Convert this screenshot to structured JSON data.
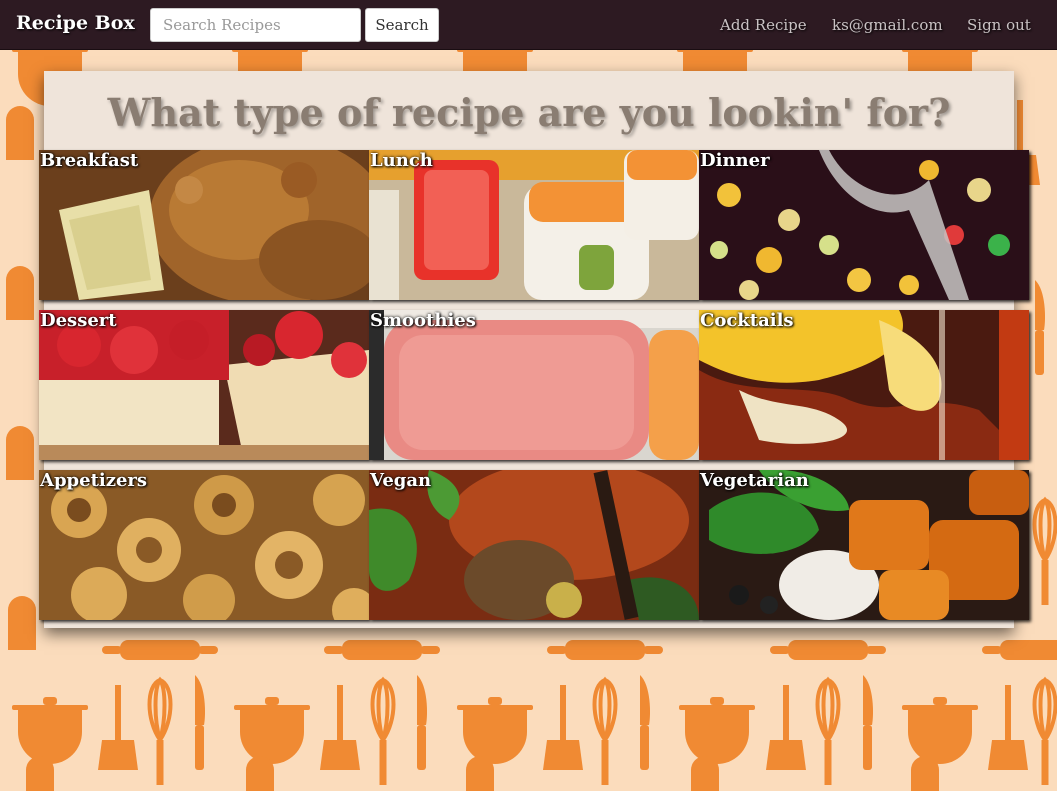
{
  "navbar": {
    "brand": "Recipe Box",
    "search_placeholder": "Search Recipes",
    "search_button": "Search",
    "links": {
      "add_recipe": "Add Recipe",
      "email": "ks@gmail.com",
      "sign_out": "Sign out"
    }
  },
  "main": {
    "heading": "What type of recipe are you lookin' for?",
    "categories": [
      {
        "label": "Breakfast"
      },
      {
        "label": "Lunch"
      },
      {
        "label": "Dinner"
      },
      {
        "label": "Dessert"
      },
      {
        "label": "Smoothies"
      },
      {
        "label": "Cocktails"
      },
      {
        "label": "Appetizers"
      },
      {
        "label": "Vegan"
      },
      {
        "label": "Vegetarian"
      }
    ]
  },
  "colors": {
    "navbar_bg": "#2d1a22",
    "page_bg": "#fbdcbc",
    "pattern": "#f08a33",
    "panel_bg": "#efe4da",
    "heading_text": "#8a7d72"
  }
}
